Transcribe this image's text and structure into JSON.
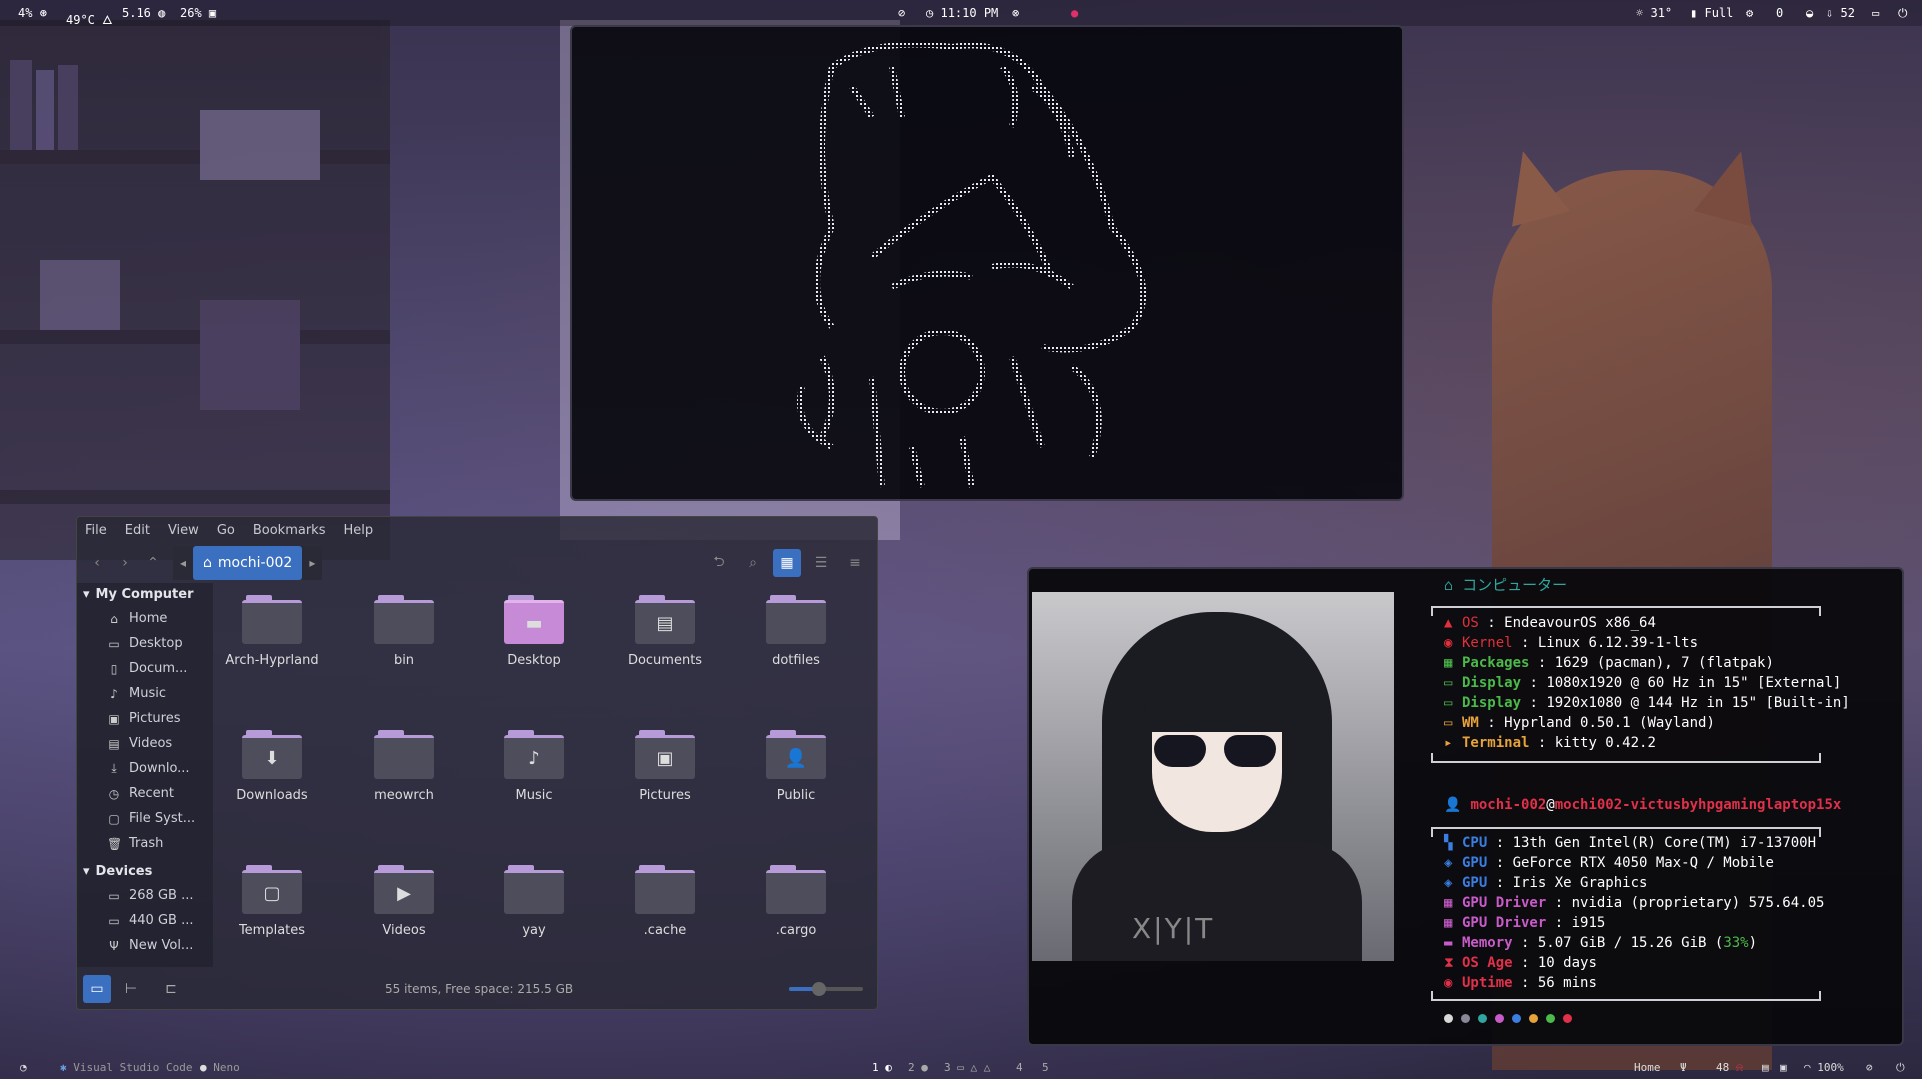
{
  "topbar": {
    "cpu": "4%",
    "temp": "49°C",
    "ram": "5.16",
    "disk": "26%",
    "clock": "11:10 PM",
    "weather": "31°",
    "battery": "Full",
    "wifi_count": "0",
    "updates": "52"
  },
  "file_manager": {
    "menu": [
      "File",
      "Edit",
      "View",
      "Go",
      "Bookmarks",
      "Help"
    ],
    "path_label": "mochi-002",
    "sidebar": {
      "computer_header": "My Computer",
      "computer_items": [
        {
          "label": "Home",
          "icon": "home-icon"
        },
        {
          "label": "Desktop",
          "icon": "desktop-icon"
        },
        {
          "label": "Docum...",
          "icon": "document-icon"
        },
        {
          "label": "Music",
          "icon": "music-icon"
        },
        {
          "label": "Pictures",
          "icon": "pictures-icon"
        },
        {
          "label": "Videos",
          "icon": "videos-icon"
        },
        {
          "label": "Downlo...",
          "icon": "download-icon"
        },
        {
          "label": "Recent",
          "icon": "recent-icon"
        },
        {
          "label": "File Syst...",
          "icon": "filesystem-icon"
        },
        {
          "label": "Trash",
          "icon": "trash-icon"
        }
      ],
      "devices_header": "Devices",
      "device_items": [
        {
          "label": "268 GB ...",
          "icon": "drive-icon"
        },
        {
          "label": "440 GB ...",
          "icon": "drive-icon"
        },
        {
          "label": "New Vol...",
          "icon": "usb-icon"
        }
      ]
    },
    "folders": [
      {
        "name": "Arch-Hyprland",
        "glyph": ""
      },
      {
        "name": "bin",
        "glyph": ""
      },
      {
        "name": "Desktop",
        "glyph": "▬"
      },
      {
        "name": "Documents",
        "glyph": "▤"
      },
      {
        "name": "dotfiles",
        "glyph": ""
      },
      {
        "name": "Downloads",
        "glyph": "⬇"
      },
      {
        "name": "meowrch",
        "glyph": ""
      },
      {
        "name": "Music",
        "glyph": "♪"
      },
      {
        "name": "Pictures",
        "glyph": "▣"
      },
      {
        "name": "Public",
        "glyph": "👤"
      },
      {
        "name": "Templates",
        "glyph": "▢"
      },
      {
        "name": "Videos",
        "glyph": "▶"
      },
      {
        "name": "yay",
        "glyph": ""
      },
      {
        "name": ".cache",
        "glyph": ""
      },
      {
        "name": ".cargo",
        "glyph": ""
      }
    ],
    "status": "55 items, Free space: 215.5 GB",
    "zoom_level": 0.4
  },
  "fetch": {
    "header": "コンピューター",
    "system": [
      {
        "key": "OS",
        "value": "EndeavourOS x86_64",
        "color": "#e0303a"
      },
      {
        "key": "Kernel",
        "value": "Linux 6.12.39-1-lts",
        "color": "#e0303a"
      },
      {
        "key": "Packages",
        "value": "1629 (pacman), 7 (flatpak)",
        "color": "#4cba4a"
      },
      {
        "key": "Display",
        "value": "1080x1920 @ 60 Hz in 15\" [External]",
        "color": "#4cba4a"
      },
      {
        "key": "Display",
        "value": "1920x1080 @ 144 Hz in 15\" [Built-in]",
        "color": "#4cba4a"
      },
      {
        "key": "WM",
        "value": "Hyprland 0.50.1 (Wayland)",
        "color": "#e6a33a"
      },
      {
        "key": "Terminal",
        "value": "kitty 0.42.2",
        "color": "#e6a33a"
      }
    ],
    "user": "mochi-002",
    "host": "mochi002-victusbyhpgaminglaptop15x",
    "hardware": [
      {
        "key": "CPU",
        "value": "13th Gen Intel(R) Core(TM) i7-13700H",
        "color": "#3a7ee0"
      },
      {
        "key": "GPU",
        "value": "GeForce RTX 4050 Max-Q / Mobile",
        "color": "#3a7ee0"
      },
      {
        "key": "GPU",
        "value": "Iris Xe Graphics",
        "color": "#3a7ee0"
      },
      {
        "key": "GPU Driver",
        "value": "nvidia (proprietary) 575.64.05",
        "color": "#c95bc9"
      },
      {
        "key": "GPU Driver",
        "value": "i915",
        "color": "#c95bc9"
      },
      {
        "key": "Memory",
        "value": "5.07 GiB / 15.26 GiB",
        "percent": "33%",
        "color": "#c95bc9"
      },
      {
        "key": "OS Age",
        "value": "10 days",
        "color": "#e0304a"
      },
      {
        "key": "Uptime",
        "value": "56 mins",
        "color": "#e0304a"
      }
    ],
    "palette": [
      "#d8d8d8",
      "#888896",
      "#2fa7a0",
      "#c95bc9",
      "#3a7ee0",
      "#e6a33a",
      "#4cba4a",
      "#e0304a"
    ]
  },
  "bottombar": {
    "apps": [
      "Visual Studio Code",
      "Neno"
    ],
    "workspaces": [
      "1",
      "2",
      "3",
      "4",
      "5"
    ],
    "location": "Home",
    "brightness": "48",
    "volume": "100%"
  }
}
